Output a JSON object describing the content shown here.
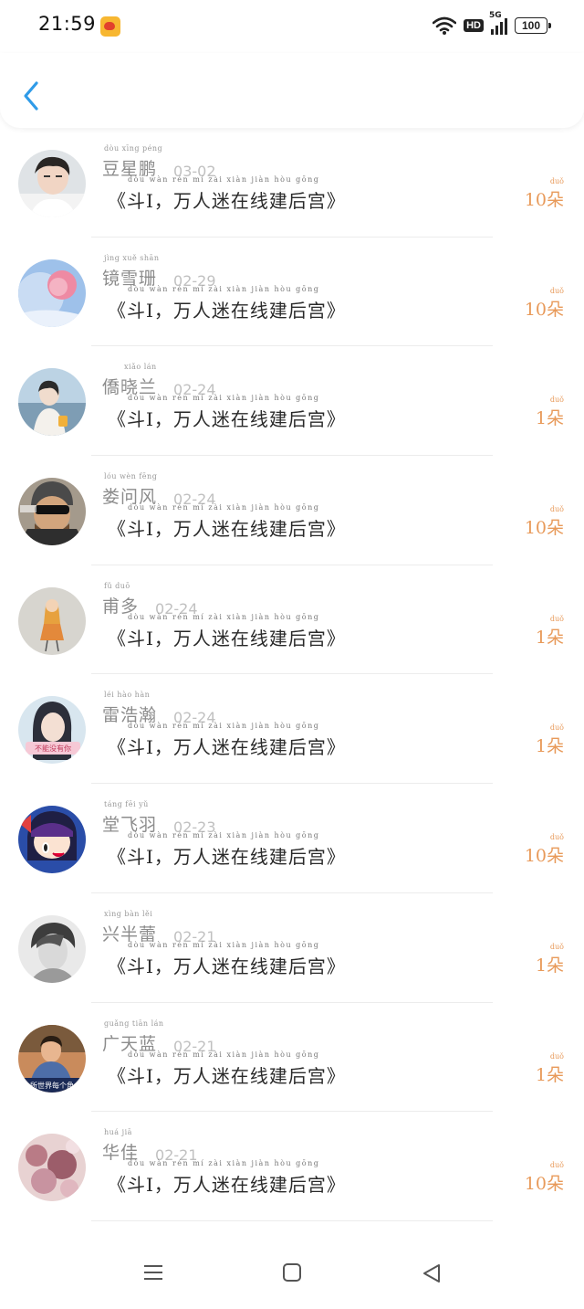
{
  "status_bar": {
    "time": "21:59",
    "network": "5G",
    "hd_label": "HD",
    "battery": "100",
    "app_icon": "weibo-icon"
  },
  "header": {
    "back_icon": "chevron-left-icon"
  },
  "colors": {
    "accent": "#2f9be8",
    "count": "#e89a5a",
    "muted": "#8c8c8c",
    "date": "#c0c0c0"
  },
  "messages": [
    {
      "name": "豆星鹏",
      "name_pinyin": "dòu xīng péng",
      "date": "03-02",
      "message": "《斗I，万人迷在线建后宫》",
      "message_pinyin": "dòu       wàn rén mí zài xiàn jiàn hòu gōng",
      "count": "10朵",
      "count_pinyin": "duǒ"
    },
    {
      "name": "镜雪珊",
      "name_pinyin": "jìng xuě shān",
      "date": "02-29",
      "message": "《斗I，万人迷在线建后宫》",
      "message_pinyin": "dòu       wàn rén mí zài xiàn jiàn hòu gōng",
      "count": "10朵",
      "count_pinyin": "duǒ"
    },
    {
      "name": "僑晓兰",
      "name_pinyin": "xiǎo lán",
      "date": "02-24",
      "message": "《斗I，万人迷在线建后宫》",
      "message_pinyin": "dòu       wàn rén mí zài xiàn jiàn hòu gōng",
      "count": "1朵",
      "count_pinyin": "duǒ"
    },
    {
      "name": "娄问风",
      "name_pinyin": "lóu wèn fēng",
      "date": "02-24",
      "message": "《斗I，万人迷在线建后宫》",
      "message_pinyin": "dòu       wàn rén mí zài xiàn jiàn hòu gōng",
      "count": "10朵",
      "count_pinyin": "duǒ"
    },
    {
      "name": "甫多",
      "name_pinyin": "fǔ duō",
      "date": "02-24",
      "message": "《斗I，万人迷在线建后宫》",
      "message_pinyin": "dòu       wàn rén mí zài xiàn jiàn hòu gōng",
      "count": "1朵",
      "count_pinyin": "duǒ"
    },
    {
      "name": "雷浩瀚",
      "name_pinyin": "léi hào hàn",
      "date": "02-24",
      "message": "《斗I，万人迷在线建后宫》",
      "message_pinyin": "dòu       wàn rén mí zài xiàn jiàn hòu gōng",
      "count": "1朵",
      "count_pinyin": "duǒ"
    },
    {
      "name": "堂飞羽",
      "name_pinyin": "táng fēi yǔ",
      "date": "02-23",
      "message": "《斗I，万人迷在线建后宫》",
      "message_pinyin": "dòu       wàn rén mí zài xiàn jiàn hòu gōng",
      "count": "10朵",
      "count_pinyin": "duǒ"
    },
    {
      "name": "兴半蕾",
      "name_pinyin": "xìng bàn lěi",
      "date": "02-21",
      "message": "《斗I，万人迷在线建后宫》",
      "message_pinyin": "dòu       wàn rén mí zài xiàn jiàn hòu gōng",
      "count": "1朵",
      "count_pinyin": "duǒ"
    },
    {
      "name": "广天蓝",
      "name_pinyin": "guǎng tiān lán",
      "date": "02-21",
      "message": "《斗I，万人迷在线建后宫》",
      "message_pinyin": "dòu       wàn rén mí zài xiàn jiàn hòu gōng",
      "count": "1朵",
      "count_pinyin": "duǒ"
    },
    {
      "name": "华佳",
      "name_pinyin": "huá jiā",
      "date": "02-21",
      "message": "《斗I，万人迷在线建后宫》",
      "message_pinyin": "dòu       wàn rén mí zài xiàn jiàn hòu gōng",
      "count": "10朵",
      "count_pinyin": "duǒ"
    }
  ],
  "avatar_texts": [
    "不能没有你",
    "所世界每个角"
  ],
  "nav_bar": {
    "menu_icon": "menu-icon",
    "home_icon": "home-square-icon",
    "back_icon": "back-triangle-icon"
  }
}
